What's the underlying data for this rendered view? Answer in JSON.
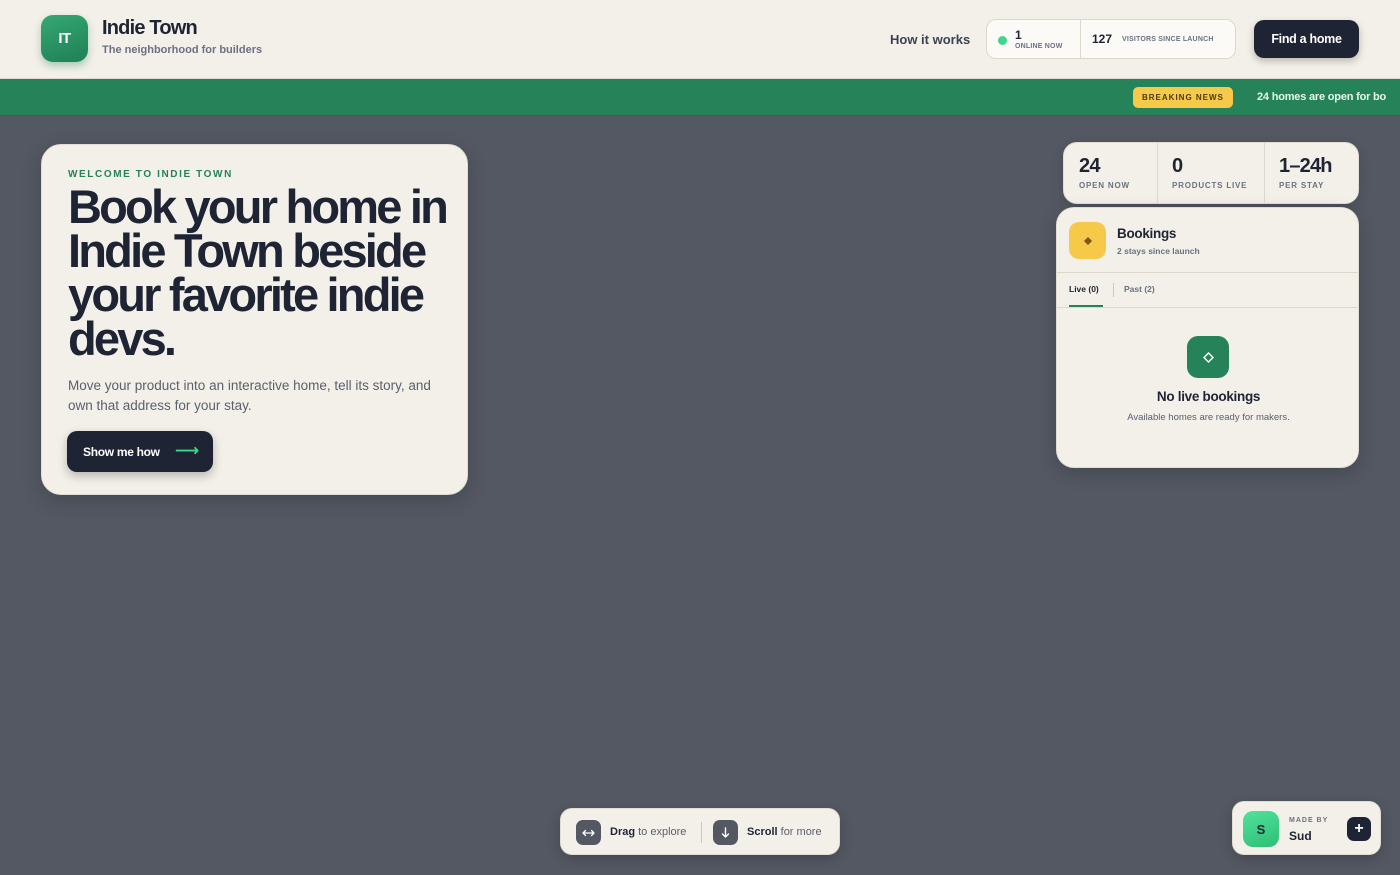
{
  "header": {
    "logo_text": "IT",
    "brand_name": "Indie Town",
    "tagline": "The neighborhood for builders",
    "nav_how": "How it works",
    "online_count": "1",
    "online_label": "ONLINE NOW",
    "visitors_count": "127",
    "visitors_label": "VISITORS SINCE LAUNCH",
    "find_button": "Find a home",
    "online_dot_color": "#3dd68c"
  },
  "ticker": {
    "badge": "BREAKING NEWS",
    "message": "24 homes are open for bo"
  },
  "hero": {
    "eyebrow": "WELCOME TO INDIE TOWN",
    "headline": "Book your home in Indie Town beside your favorite indie devs.",
    "description": "Move your product into an interactive home, tell its story, and own that address for your stay.",
    "cta": "Show me how",
    "cta_arrow": "⟶"
  },
  "stats": [
    {
      "value": "24",
      "label": "OPEN NOW"
    },
    {
      "value": "0",
      "label": "PRODUCTS LIVE"
    },
    {
      "value": "1–24h",
      "label": "PER STAY"
    }
  ],
  "bookings": {
    "icon": "diamond-icon",
    "title": "Bookings",
    "subtitle": "2 stays since launch",
    "tab_live": "Live (0)",
    "tab_past": "Past (2)",
    "empty_title": "No live bookings",
    "empty_subtitle": "Available homes are ready for makers."
  },
  "hints": {
    "drag_bold": "Drag",
    "drag_rest": " to explore",
    "scroll_bold": "Scroll",
    "scroll_rest": " for more"
  },
  "madeby": {
    "avatar": "S",
    "label": "MADE BY",
    "name": "Sud",
    "plus": "+"
  },
  "colors": {
    "accent_green": "#258259",
    "dark": "#1e2433",
    "canvas": "#545863",
    "card": "#f3f0e9",
    "badge_yellow": "#f7c948"
  }
}
